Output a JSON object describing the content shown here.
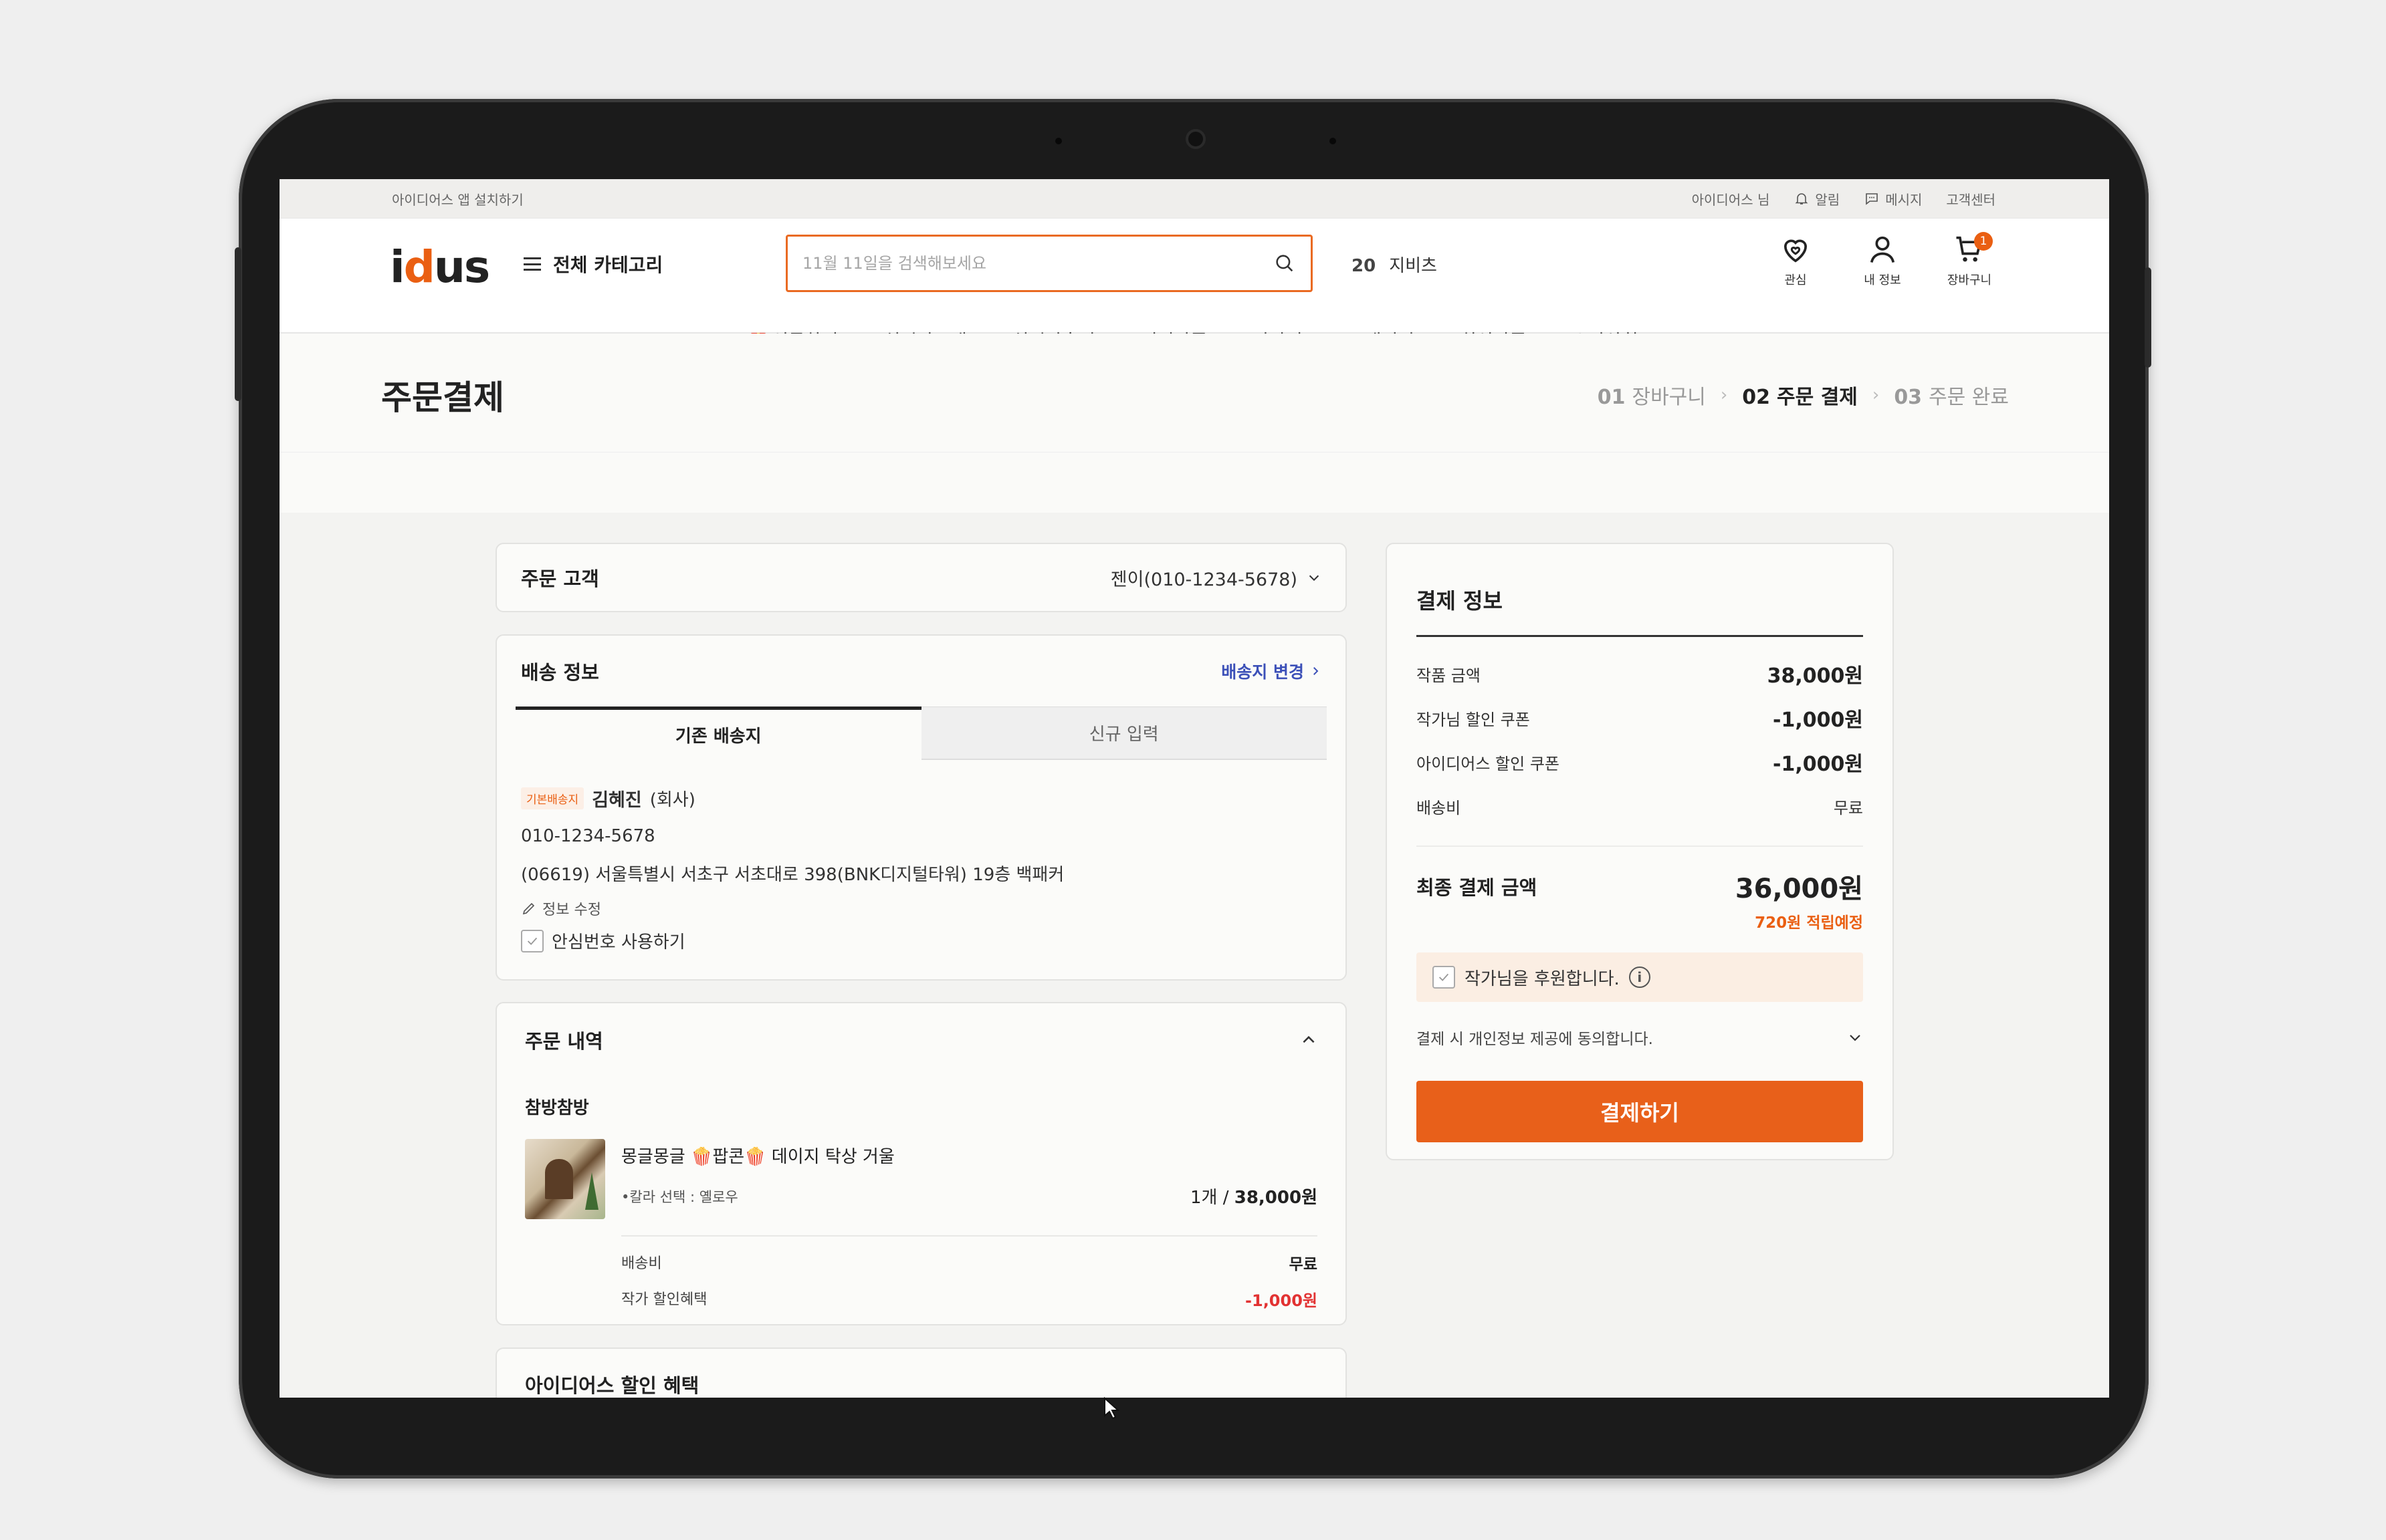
{
  "utility": {
    "install_app": "아이디어스 앱 설치하기",
    "user": "아이디어스 님",
    "alarm": "알림",
    "message": "메시지",
    "support": "고객센터"
  },
  "header": {
    "logo": "idus",
    "category_button": "전체 카테고리",
    "search_placeholder": "11월 11일을 검색해보세요",
    "keyword_rank": "20",
    "keyword": "지비츠",
    "icons": {
      "wish": "관심",
      "my_info": "내 정보",
      "cart": "장바구니",
      "cart_count": "1"
    }
  },
  "gnb": [
    "선물하기",
    "실시간구매",
    "실시간후기",
    "인기작품",
    "작가피드",
    "매거진",
    "최신작품",
    "소담상회"
  ],
  "page": {
    "title": "주문결제",
    "steps": [
      {
        "num": "01",
        "label": "장바구니"
      },
      {
        "num": "02",
        "label": "주문 결제"
      },
      {
        "num": "03",
        "label": "주문 완료"
      }
    ]
  },
  "customer": {
    "label": "주문 고객",
    "value": "젠이(010-1234-5678)"
  },
  "shipping": {
    "title": "배송 정보",
    "change_link": "배송지 변경",
    "tab_existing": "기존 배송지",
    "tab_new": "신규 입력",
    "default_chip": "기본배송지",
    "name": "김혜진",
    "name_tag": "(회사)",
    "phone": "010-1234-5678",
    "address": "(06619) 서울특별시 서초구 서초대로 398(BNK디지털타워) 19층 백패커",
    "edit": "정보 수정",
    "safe_number": "안심번호 사용하기"
  },
  "order": {
    "title": "주문 내역",
    "shop": "참방참방",
    "item_name": "몽글몽글 🍿팝콘🍿 데이지 탁상 거울",
    "option": "•칼라 선택 : 옐로우",
    "qty": "1개",
    "price": "38,000원",
    "ship_label": "배송비",
    "ship_value": "무료",
    "discount_label": "작가 할인혜택",
    "discount_value": "-1,000원"
  },
  "idus_discount": {
    "title": "아이디어스 할인 혜택"
  },
  "payment": {
    "title": "결제 정보",
    "rows": [
      {
        "label": "작품 금액",
        "value": "38,000원"
      },
      {
        "label": "작가님 할인 쿠폰",
        "value": "-1,000원"
      },
      {
        "label": "아이디어스 할인 쿠폰",
        "value": "-1,000원"
      }
    ],
    "ship_label": "배송비",
    "ship_value": "무료",
    "total_label": "최종 결제 금액",
    "total_value": "36,000원",
    "point": "720원 적립예정",
    "support_artist": "작가님을 후원합니다.",
    "agree": "결제 시 개인정보 제공에 동의합니다.",
    "pay_button": "결제하기"
  },
  "colors": {
    "accent": "#e8601a",
    "link": "#3c50b8",
    "discount": "#e23232"
  }
}
